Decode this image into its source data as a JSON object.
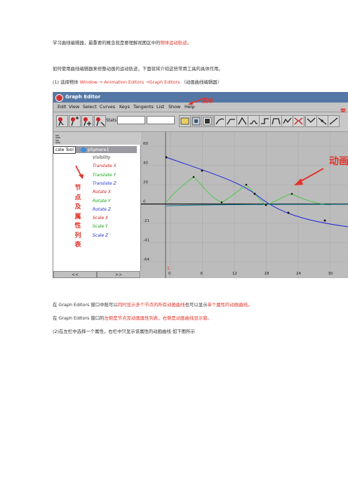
{
  "doc": {
    "p1": {
      "a": "学习曲线编辑器，最重要的概念就是要理解视图区中的",
      "b": "物体运动轨迹。"
    },
    "p2": "如何使用曲线编辑器来修整动画的运动轨迹，下面就将介绍这些常用工具的具体作用。",
    "p3": {
      "a": "(1) 选择物体 ",
      "b": "Window → Animation Editors →Graph Editors",
      "c": " （动画曲线编辑器）"
    },
    "p4": {
      "a": "在 Graph Editors 窗口中既可以",
      "b": "同时显示多个节点的所有动画曲线",
      "c": "也可以显示",
      "d": "单个属性的动画曲线。"
    },
    "p5": {
      "a": "在 Graph Editors 窗口的",
      "b": "左侧是节点及动画属性列表，右侧是动画曲线显示窗。"
    },
    "p6": "(2)在左栏中选择一个属性，右栏中只显示该属性的动画曲线  如下图所示"
  },
  "editor": {
    "title": "Graph Editor",
    "menu": [
      "Edit",
      "View",
      "Select",
      "Curves",
      "Keys",
      "Tangents",
      "List",
      "Show",
      "Help"
    ],
    "stats_label": "Stats",
    "tool_label": "cale Tool",
    "object": "pSphere1",
    "attributes": [
      {
        "name": "Visibility",
        "color": "k"
      },
      {
        "name": "Translate X",
        "color": "r"
      },
      {
        "name": "Translate Y",
        "color": "g"
      },
      {
        "name": "Translate Z",
        "color": "b"
      },
      {
        "name": "Rotate X",
        "color": "r"
      },
      {
        "name": "Rotate Y",
        "color": "g"
      },
      {
        "name": "Rotate Z",
        "color": "b"
      },
      {
        "name": "Scale X",
        "color": "r"
      },
      {
        "name": "Scale Y",
        "color": "g"
      },
      {
        "name": "Scale Z",
        "color": "b"
      }
    ],
    "buttons": [
      "<<",
      ">>"
    ],
    "y_ticks": [
      "60",
      "40",
      "20",
      "0",
      "-21",
      "-41",
      "-64"
    ],
    "x_ticks": [
      "0",
      "6",
      "12",
      "18",
      "24",
      "30"
    ],
    "frame_marker": "1"
  },
  "annotations": {
    "menu": "菜单",
    "right": "常",
    "vertical": [
      "节",
      "点",
      "及",
      "属",
      "性",
      "列",
      "表"
    ],
    "anim": "动画"
  },
  "colors": {
    "accent_red": "#e0352b",
    "title_bar": "#5577a6",
    "curve_blue": "#2222dd",
    "curve_green": "#33cc33"
  }
}
